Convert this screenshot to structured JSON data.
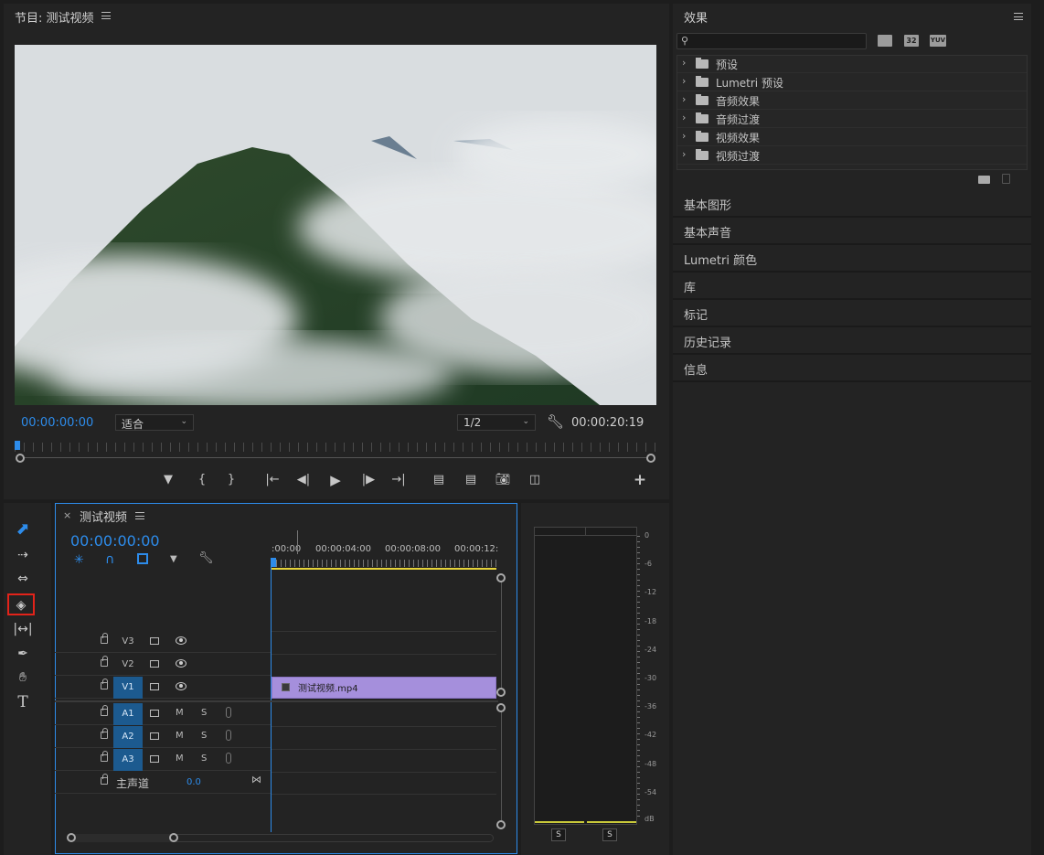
{
  "program_monitor": {
    "title": "节目: 测试视频",
    "timecode_left": "00:00:00:00",
    "fit_select": "适合",
    "resolution_select": "1/2",
    "timecode_right": "00:00:20:19"
  },
  "effects_panel": {
    "title": "效果",
    "icon_labels": [
      "32",
      "YUV"
    ],
    "search_placeholder": "",
    "folders": [
      {
        "label": "预设"
      },
      {
        "label": "Lumetri 预设"
      },
      {
        "label": "音频效果"
      },
      {
        "label": "音频过渡"
      },
      {
        "label": "视频效果"
      },
      {
        "label": "视频过渡"
      }
    ]
  },
  "side_sections": [
    "基本图形",
    "基本声音",
    "Lumetri 颜色",
    "库",
    "标记",
    "历史记录",
    "信息"
  ],
  "timeline": {
    "tab_title": "测试视频",
    "close": "×",
    "timecode": "00:00:00:00",
    "ruler": [
      ":00:00",
      "00:00:04:00",
      "00:00:08:00",
      "00:00:12:"
    ],
    "video_tracks": [
      "V3",
      "V2",
      "V1"
    ],
    "audio_tracks": [
      "A1",
      "A2",
      "A3"
    ],
    "mute_label": "M",
    "solo_label": "S",
    "master": {
      "label": "主声道",
      "value": "0.0"
    },
    "clip_name": "测试视频.mp4"
  },
  "audio_meter": {
    "scale": [
      "0",
      "-6",
      "-12",
      "-18",
      "-24",
      "-30",
      "-36",
      "-42",
      "-48",
      "-54",
      "dB"
    ],
    "solo_buttons": [
      "S",
      "S"
    ]
  },
  "tools": [
    "selection-tool",
    "track-select-tool",
    "ripple-edit-tool",
    "razor-tool",
    "slip-tool",
    "pen-tool",
    "hand-tool",
    "type-tool"
  ],
  "colors": {
    "accent_blue": "#2d8ceb",
    "clip_purple": "#a58fdc",
    "highlight_red": "#e2231a",
    "track_highlight": "#1c5a8f"
  }
}
